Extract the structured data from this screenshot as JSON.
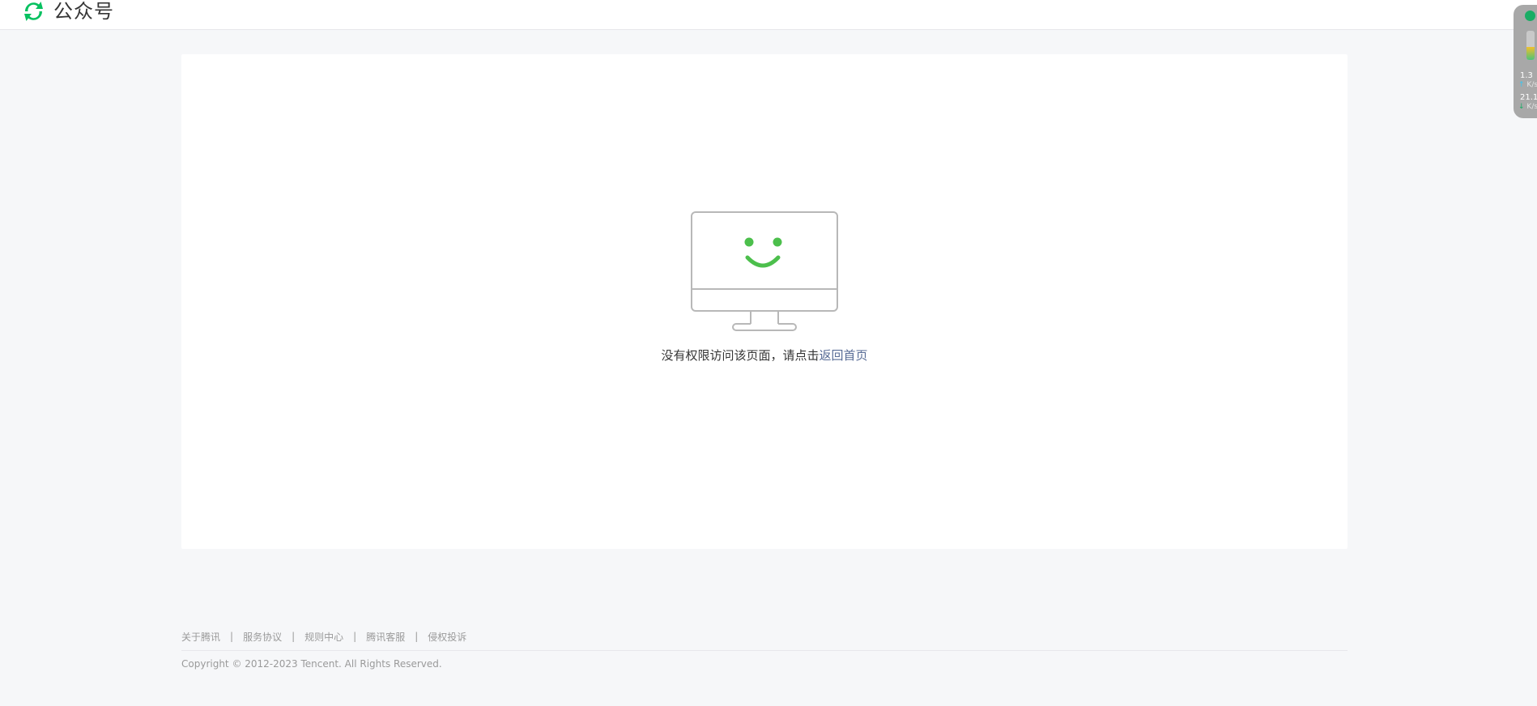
{
  "header": {
    "logo_text": "公众号",
    "logo_icon": "wechat-official-accounts-logo",
    "brand_color": "#1aad19"
  },
  "main": {
    "illustration": "smiling-monitor-icon",
    "message_prefix": "没有权限访问该页面，请点击",
    "home_link": "返回首页",
    "link_color": "#576b95"
  },
  "footer": {
    "links": [
      "关于腾讯",
      "服务协议",
      "规则中心",
      "腾讯客服",
      "侵权投诉"
    ],
    "separator": "|",
    "copyright": "Copyright © 2012-2023 Tencent. All Rights Reserved."
  },
  "network_widget": {
    "usage_level": 0.45,
    "upload_value": "1.3",
    "upload_unit": "K/s",
    "download_value": "21.1",
    "download_unit": "K/s",
    "upload_arrow": "↑",
    "download_arrow": "↓"
  }
}
